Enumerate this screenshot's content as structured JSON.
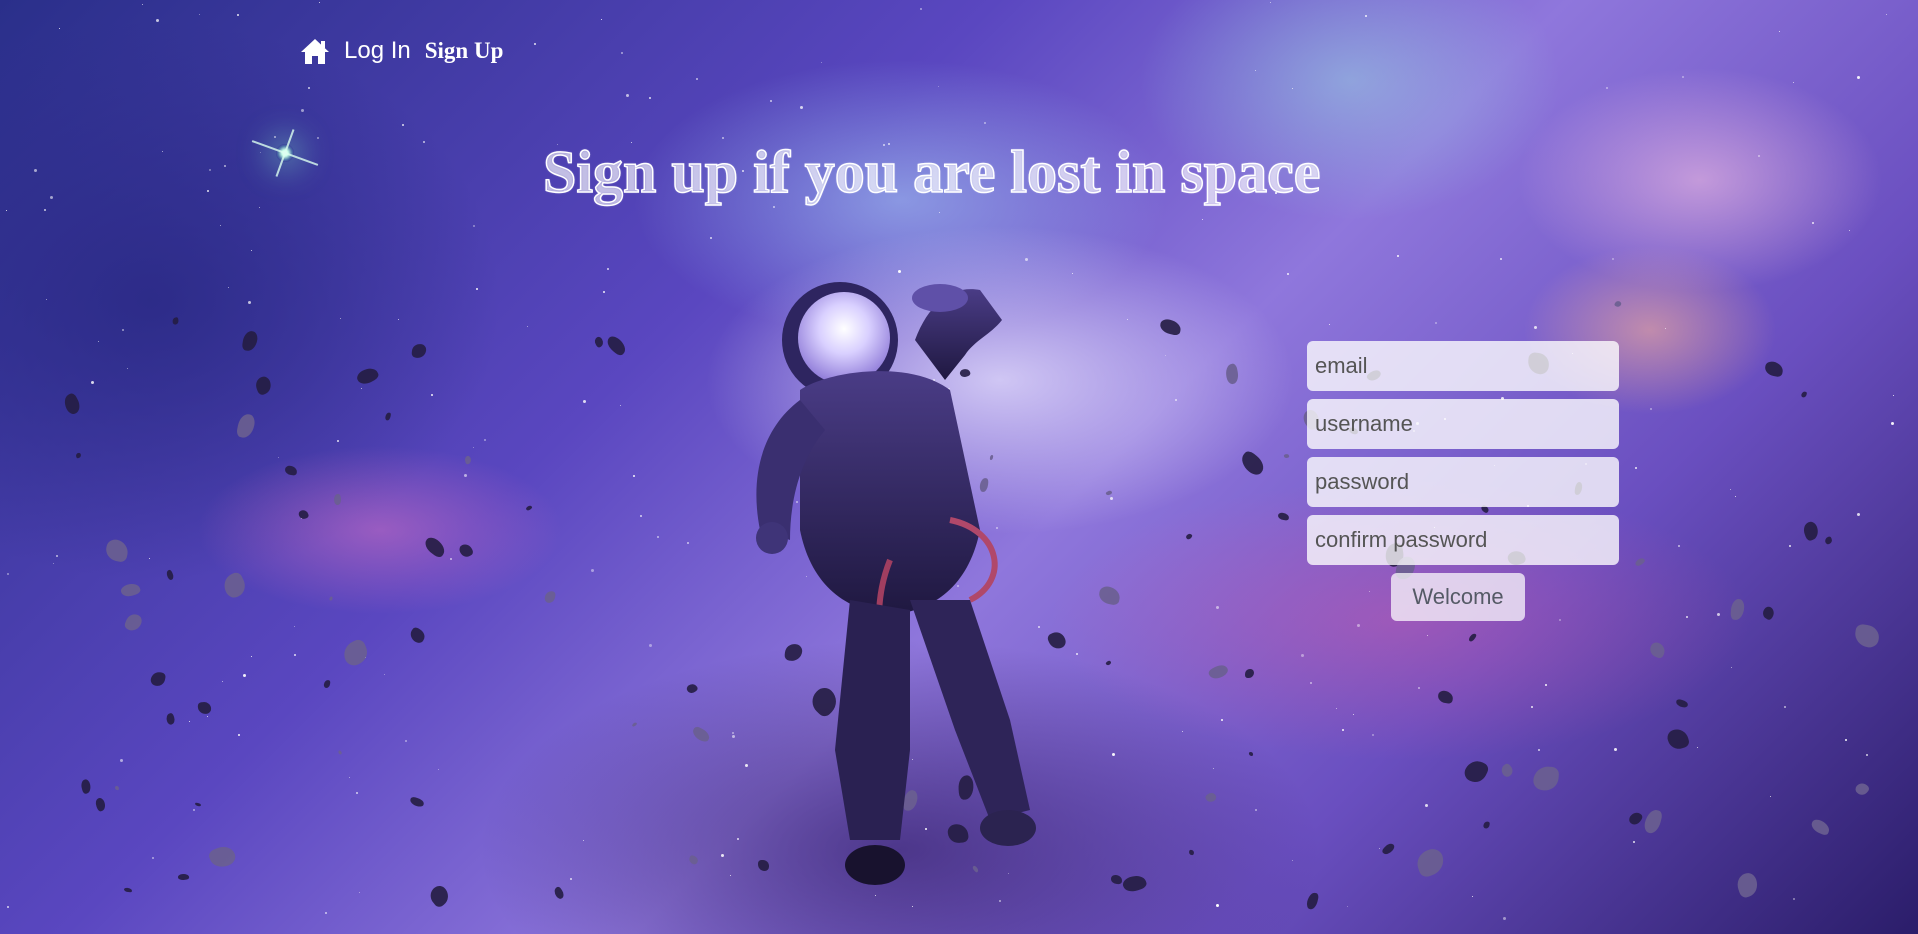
{
  "nav": {
    "home_icon": "home-icon",
    "login_label": "Log In",
    "signup_label": "Sign Up"
  },
  "hero": {
    "title": "Sign up if you are lost in space"
  },
  "form": {
    "email_placeholder": "email",
    "username_placeholder": "username",
    "password_placeholder": "password",
    "confirm_password_placeholder": "confirm password",
    "submit_label": "Welcome"
  },
  "colors": {
    "nav_text": "#ffffff",
    "field_background": "#ffffffc7",
    "button_text": "#555a66"
  }
}
